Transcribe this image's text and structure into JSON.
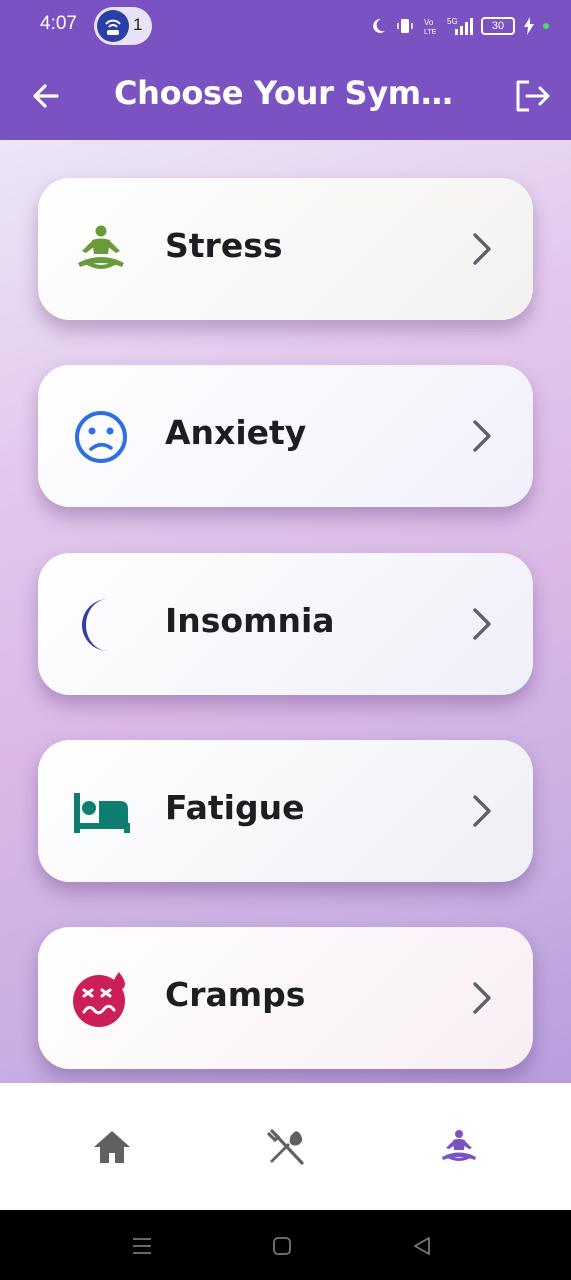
{
  "status_bar": {
    "time": "4:07",
    "notification_count": "1",
    "battery": "30"
  },
  "app_bar": {
    "title": "Choose Your Sympt...",
    "background": "#7b52c2"
  },
  "symptoms": [
    {
      "label": "Stress",
      "icon": "meditation-icon",
      "icon_color": "#6a9a3a",
      "card_bg": "#f3f1f0"
    },
    {
      "label": "Anxiety",
      "icon": "confused-face-icon",
      "icon_color": "#2f6fe0",
      "card_bg": "#f1f0fb"
    },
    {
      "label": "Insomnia",
      "icon": "moon-icon",
      "icon_color": "#2f3ea6",
      "card_bg": "#f0eef8"
    },
    {
      "label": "Fatigue",
      "icon": "bed-icon",
      "icon_color": "#0e7f6e",
      "card_bg": "#eef0f5"
    },
    {
      "label": "Cramps",
      "icon": "dizzy-face-icon",
      "icon_color": "#cc1f58",
      "card_bg": "#f8eef4"
    }
  ],
  "bottom_nav": {
    "items": [
      {
        "icon": "home-icon",
        "active": false
      },
      {
        "icon": "restaurant-icon",
        "active": false
      },
      {
        "icon": "meditation-icon",
        "active": true
      }
    ],
    "active_color": "#7b52c2",
    "inactive_color": "#606060"
  }
}
